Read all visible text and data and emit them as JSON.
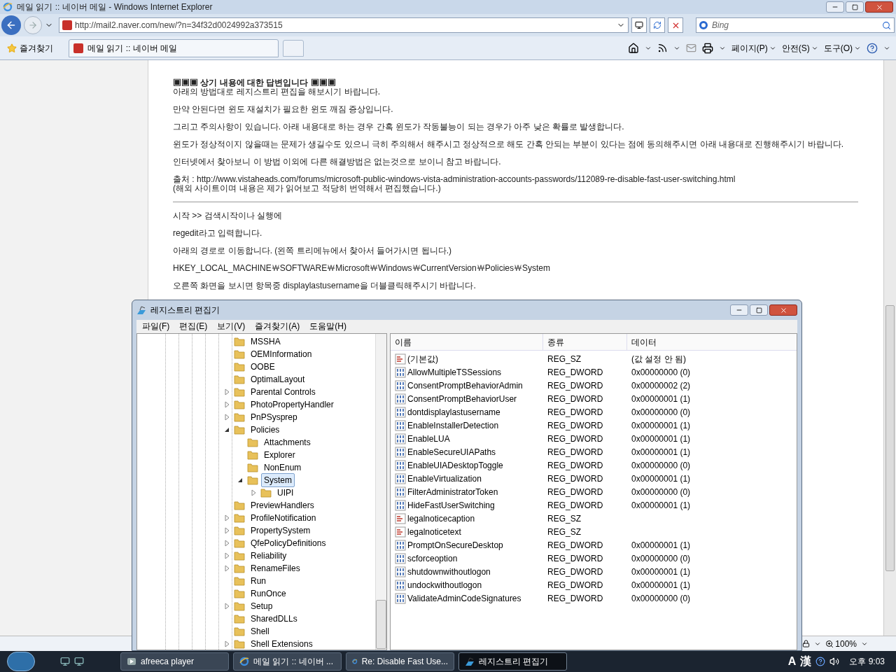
{
  "browser": {
    "title": "메일 읽기 :: 네이버 메일 - Windows Internet Explorer",
    "url": "http://mail2.naver.com/new/?n=34f32d0024992a373515",
    "search": {
      "placeholder": "Bing"
    },
    "favorites": "즐겨찾기",
    "tab": "메일 읽기 :: 네이버 메일",
    "commands": [
      "페이지(P)",
      "안전(S)",
      "도구(O)"
    ],
    "zoom": "100%"
  },
  "email": {
    "heading": "▣▣▣ 상기 내용에 대한 답변입니다 ▣▣▣",
    "intro": "아래의 방법대로 레지스트리 편집을 해보시기 바랍니다.",
    "paragraphs": [
      "만약 안된다면 윈도 재설치가 필요한 윈도 깨짐 증상입니다.",
      "그리고 주의사항이 있습니다. 아래 내용대로 하는 경우 간혹 윈도가 작동불능이 되는 경우가 아주 낮은 확률로 발생합니다.",
      "윈도가 정상적이지 않을때는 문제가 생길수도 있으니 극히 주의해서 해주시고 정상적으로 해도 간혹 안되는 부분이 있다는 점에 동의해주시면 아래 내용대로 진행해주시기 바랍니다.",
      "인터넷에서 찾아보니 이 방법 이외에 다른 해결방법은 없는것으로 보이니 참고 바랍니다.",
      "출처 : http://www.vistaheads.com/forums/microsoft-public-windows-vista-administration-accounts-passwords/112089-re-disable-fast-user-switching.html\n(해외 사이트이며 내용은 제가 읽어보고 적당히 번역해서 편집했습니다.)"
    ],
    "steps": [
      "시작 >> 검색시작이나 실행에",
      "regedit라고 입력합니다.",
      "아래의 경로로 이동합니다. (왼쪽 트리메뉴에서 찾아서 들어가시면 됩니다.)",
      "HKEY_LOCAL_MACHINE￦SOFTWARE￦Microsoft￦Windows￦CurrentVersion￦Policies￦System",
      "오른쪽 화면을 보시면 항목중 displaylastusername을 더블클릭해주시기 바랍니다."
    ]
  },
  "regedit": {
    "title": "레지스트리 편집기",
    "menu": [
      "파일(F)",
      "편집(E)",
      "보기(V)",
      "즐겨찾기(A)",
      "도움말(H)"
    ],
    "tree": [
      {
        "label": "MSSHA",
        "selected": false
      },
      {
        "label": "OEMInformation",
        "selected": false
      },
      {
        "label": "OOBE",
        "selected": false
      },
      {
        "label": "OptimalLayout",
        "selected": false
      },
      {
        "label": "Parental Controls",
        "expanded": false,
        "selected": false
      },
      {
        "label": "PhotoPropertyHandler",
        "expanded": false,
        "selected": false
      },
      {
        "label": "PnPSysprep",
        "expanded": false,
        "selected": false
      },
      {
        "label": "Policies",
        "expanded": true,
        "selected": false,
        "children": [
          {
            "label": "Attachments",
            "selected": false
          },
          {
            "label": "Explorer",
            "selected": false
          },
          {
            "label": "NonEnum",
            "selected": false
          },
          {
            "label": "System",
            "expanded": true,
            "selected": true,
            "children": [
              {
                "label": "UIPI",
                "expanded": false,
                "selected": false
              }
            ]
          }
        ]
      },
      {
        "label": "PreviewHandlers",
        "selected": false
      },
      {
        "label": "ProfileNotification",
        "expanded": false,
        "selected": false
      },
      {
        "label": "PropertySystem",
        "expanded": false,
        "selected": false
      },
      {
        "label": "QfePolicyDefinitions",
        "expanded": false,
        "selected": false
      },
      {
        "label": "Reliability",
        "expanded": false,
        "selected": false
      },
      {
        "label": "RenameFiles",
        "expanded": false,
        "selected": false
      },
      {
        "label": "Run",
        "selected": false
      },
      {
        "label": "RunOnce",
        "selected": false
      },
      {
        "label": "Setup",
        "expanded": false,
        "selected": false
      },
      {
        "label": "SharedDLLs",
        "selected": false
      },
      {
        "label": "Shell",
        "selected": false
      },
      {
        "label": "Shell Extensions",
        "expanded": false,
        "selected": false
      }
    ],
    "columns": [
      "이름",
      "종류",
      "데이터"
    ],
    "values": [
      {
        "kind": "string",
        "name": "(기본값)",
        "type": "REG_SZ",
        "data": "(값 설정 안 됨)"
      },
      {
        "kind": "dword",
        "name": "AllowMultipleTSSessions",
        "type": "REG_DWORD",
        "data": "0x00000000 (0)"
      },
      {
        "kind": "dword",
        "name": "ConsentPromptBehaviorAdmin",
        "type": "REG_DWORD",
        "data": "0x00000002 (2)"
      },
      {
        "kind": "dword",
        "name": "ConsentPromptBehaviorUser",
        "type": "REG_DWORD",
        "data": "0x00000001 (1)"
      },
      {
        "kind": "dword",
        "name": "dontdisplaylastusername",
        "type": "REG_DWORD",
        "data": "0x00000000 (0)"
      },
      {
        "kind": "dword",
        "name": "EnableInstallerDetection",
        "type": "REG_DWORD",
        "data": "0x00000001 (1)"
      },
      {
        "kind": "dword",
        "name": "EnableLUA",
        "type": "REG_DWORD",
        "data": "0x00000001 (1)"
      },
      {
        "kind": "dword",
        "name": "EnableSecureUIAPaths",
        "type": "REG_DWORD",
        "data": "0x00000001 (1)"
      },
      {
        "kind": "dword",
        "name": "EnableUIADesktopToggle",
        "type": "REG_DWORD",
        "data": "0x00000000 (0)"
      },
      {
        "kind": "dword",
        "name": "EnableVirtualization",
        "type": "REG_DWORD",
        "data": "0x00000001 (1)"
      },
      {
        "kind": "dword",
        "name": "FilterAdministratorToken",
        "type": "REG_DWORD",
        "data": "0x00000000 (0)"
      },
      {
        "kind": "dword",
        "name": "HideFastUserSwitching",
        "type": "REG_DWORD",
        "data": "0x00000001 (1)"
      },
      {
        "kind": "string",
        "name": "legalnoticecaption",
        "type": "REG_SZ"
      },
      {
        "kind": "string",
        "name": "legalnoticetext",
        "type": "REG_SZ"
      },
      {
        "kind": "dword",
        "name": "PromptOnSecureDesktop",
        "type": "REG_DWORD",
        "data": "0x00000001 (1)"
      },
      {
        "kind": "dword",
        "name": "scforceoption",
        "type": "REG_DWORD",
        "data": "0x00000000 (0)"
      },
      {
        "kind": "dword",
        "name": "shutdownwithoutlogon",
        "type": "REG_DWORD",
        "data": "0x00000001 (1)"
      },
      {
        "kind": "dword",
        "name": "undockwithoutlogon",
        "type": "REG_DWORD",
        "data": "0x00000001 (1)"
      },
      {
        "kind": "dword",
        "name": "ValidateAdminCodeSignatures",
        "type": "REG_DWORD",
        "data": "0x00000000 (0)"
      }
    ]
  },
  "taskbar": {
    "items": [
      {
        "kind": "player",
        "label": "afreeca player",
        "selected": false
      },
      {
        "kind": "ie",
        "label": "메일 읽기 :: 네이버 ...",
        "selected": false
      },
      {
        "kind": "ie",
        "label": "Re: Disable Fast Use...",
        "selected": false
      },
      {
        "kind": "regedit",
        "label": "레지스트리 편집기",
        "selected": true
      }
    ],
    "tray": [
      "A",
      "漢"
    ],
    "clock": "오후 9:03"
  }
}
